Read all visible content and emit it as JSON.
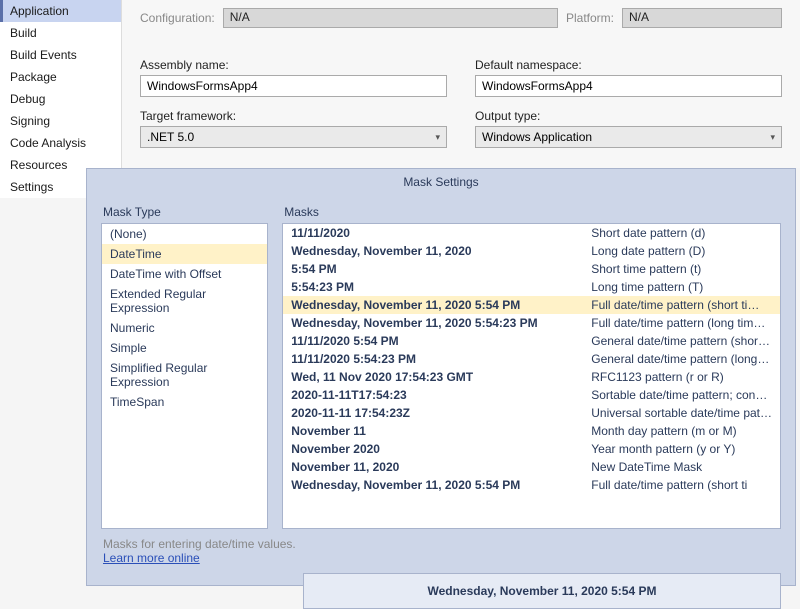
{
  "sidebar": {
    "items": [
      {
        "label": "Application",
        "active": true
      },
      {
        "label": "Build"
      },
      {
        "label": "Build Events"
      },
      {
        "label": "Package"
      },
      {
        "label": "Debug"
      },
      {
        "label": "Signing"
      },
      {
        "label": "Code Analysis"
      },
      {
        "label": "Resources"
      },
      {
        "label": "Settings"
      }
    ]
  },
  "top": {
    "config_label": "Configuration:",
    "config_value": "N/A",
    "platform_label": "Platform:",
    "platform_value": "N/A",
    "assembly_label": "Assembly name:",
    "assembly_value": "WindowsFormsApp4",
    "namespace_label": "Default namespace:",
    "namespace_value": "WindowsFormsApp4",
    "framework_label": "Target framework:",
    "framework_value": ".NET 5.0",
    "output_label": "Output type:",
    "output_value": "Windows Application"
  },
  "mask": {
    "title": "Mask Settings",
    "type_header": "Mask Type",
    "masks_header": "Masks",
    "types": [
      "(None)",
      "DateTime",
      "DateTime with Offset",
      "Extended Regular Expression",
      "Numeric",
      "Simple",
      "Simplified Regular Expression",
      "TimeSpan"
    ],
    "selected_type_index": 1,
    "rows": [
      {
        "sample": "11/11/2020",
        "desc": "Short date pattern (d)"
      },
      {
        "sample": "Wednesday, November 11, 2020",
        "desc": "Long date pattern (D)"
      },
      {
        "sample": "5:54 PM",
        "desc": "Short time pattern (t)"
      },
      {
        "sample": "5:54:23 PM",
        "desc": "Long time pattern (T)"
      },
      {
        "sample": "Wednesday, November 11, 2020 5:54 PM",
        "desc": "Full date/time pattern (short ti…",
        "selected": true
      },
      {
        "sample": "Wednesday, November 11, 2020 5:54:23 PM",
        "desc": "Full date/time pattern (long tim…"
      },
      {
        "sample": "11/11/2020 5:54 PM",
        "desc": "General date/time pattern (shor…"
      },
      {
        "sample": "11/11/2020 5:54:23 PM",
        "desc": "General date/time pattern (long…"
      },
      {
        "sample": "Wed, 11 Nov 2020 17:54:23 GMT",
        "desc": "RFC1123 pattern (r or R)"
      },
      {
        "sample": "2020-11-11T17:54:23",
        "desc": "Sortable date/time pattern; con…"
      },
      {
        "sample": "2020-11-11 17:54:23Z",
        "desc": "Universal sortable date/time pat…"
      },
      {
        "sample": "November 11",
        "desc": "Month day pattern (m or M)"
      },
      {
        "sample": "November 2020",
        "desc": "Year month pattern (y or Y)"
      },
      {
        "sample": "November 11, 2020",
        "desc": "New DateTime Mask"
      },
      {
        "sample": "Wednesday, November 11, 2020 5:54 PM",
        "desc": "Full date/time pattern (short ti"
      }
    ],
    "help_text": "Masks for entering date/time values.",
    "help_link": "Learn more online",
    "preview": "Wednesday, November 11, 2020 5:54 PM"
  }
}
